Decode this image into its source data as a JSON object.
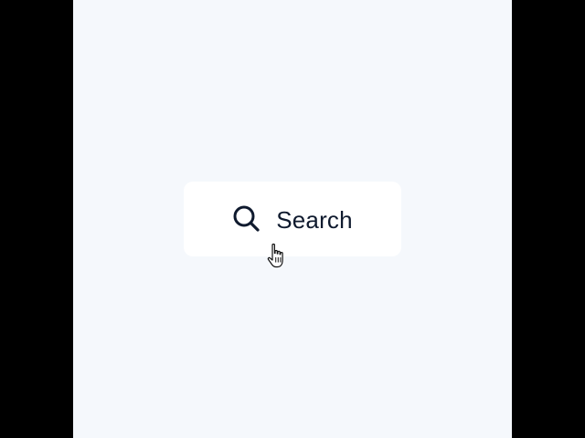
{
  "search": {
    "label": "Search",
    "icon": "search-icon"
  },
  "cursor": {
    "icon": "hand-pointer-icon"
  },
  "colors": {
    "background": "#F5F8FC",
    "letterbox": "#000000",
    "button_background": "#FFFFFF",
    "text": "#0F1A2E"
  }
}
